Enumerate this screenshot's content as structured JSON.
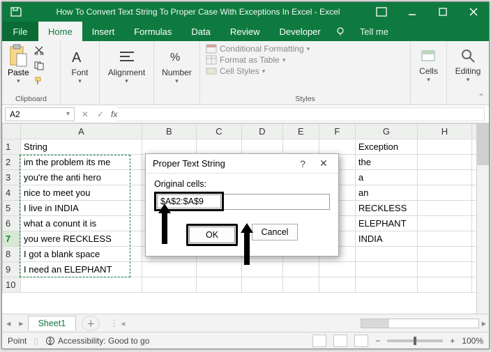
{
  "titlebar": {
    "title": "How To Convert Text String To Proper Case With Exceptions In Excel  -  Excel"
  },
  "menubar": {
    "file": "File",
    "tabs": [
      "Home",
      "Insert",
      "Formulas",
      "Data",
      "Review",
      "Developer"
    ],
    "active": 0,
    "tellme": "Tell me"
  },
  "ribbon": {
    "clipboard": {
      "paste": "Paste",
      "label": "Clipboard"
    },
    "font": {
      "label": "Font"
    },
    "alignment": {
      "label": "Alignment"
    },
    "number": {
      "label": "Number"
    },
    "styles": {
      "conditional": "Conditional Formatting",
      "table": "Format as Table",
      "cell": "Cell Styles",
      "label": "Styles"
    },
    "cells": {
      "label": "Cells"
    },
    "editing": {
      "label": "Editing"
    }
  },
  "formula": {
    "namebox": "A2",
    "fx": "fx"
  },
  "grid": {
    "columns": [
      "A",
      "B",
      "C",
      "D",
      "E",
      "F",
      "G",
      "H"
    ],
    "rows": [
      {
        "n": 1,
        "A": "String",
        "G": "Exception"
      },
      {
        "n": 2,
        "A": "im the problem its me",
        "G": "the"
      },
      {
        "n": 3,
        "A": "you're the anti hero",
        "G": "a"
      },
      {
        "n": 4,
        "A": "nice to meet you",
        "G": "an"
      },
      {
        "n": 5,
        "A": "I live in INDIA",
        "G": "RECKLESS"
      },
      {
        "n": 6,
        "A": "what a conunt it is",
        "G": "ELEPHANT"
      },
      {
        "n": 7,
        "A": "you were RECKLESS",
        "G": "INDIA"
      },
      {
        "n": 8,
        "A": "I got a blank space",
        "G": ""
      },
      {
        "n": 9,
        "A": "I need an ELEPHANT",
        "G": ""
      },
      {
        "n": 10,
        "A": "",
        "G": ""
      }
    ]
  },
  "dialog": {
    "title": "Proper Text String",
    "field_label": "Original cells:",
    "value": "$A$2:$A$9",
    "ok": "OK",
    "cancel": "Cancel"
  },
  "sheetbar": {
    "sheet": "Sheet1"
  },
  "statusbar": {
    "mode": "Point",
    "accessibility": "Accessibility: Good to go",
    "zoom": "100%"
  }
}
